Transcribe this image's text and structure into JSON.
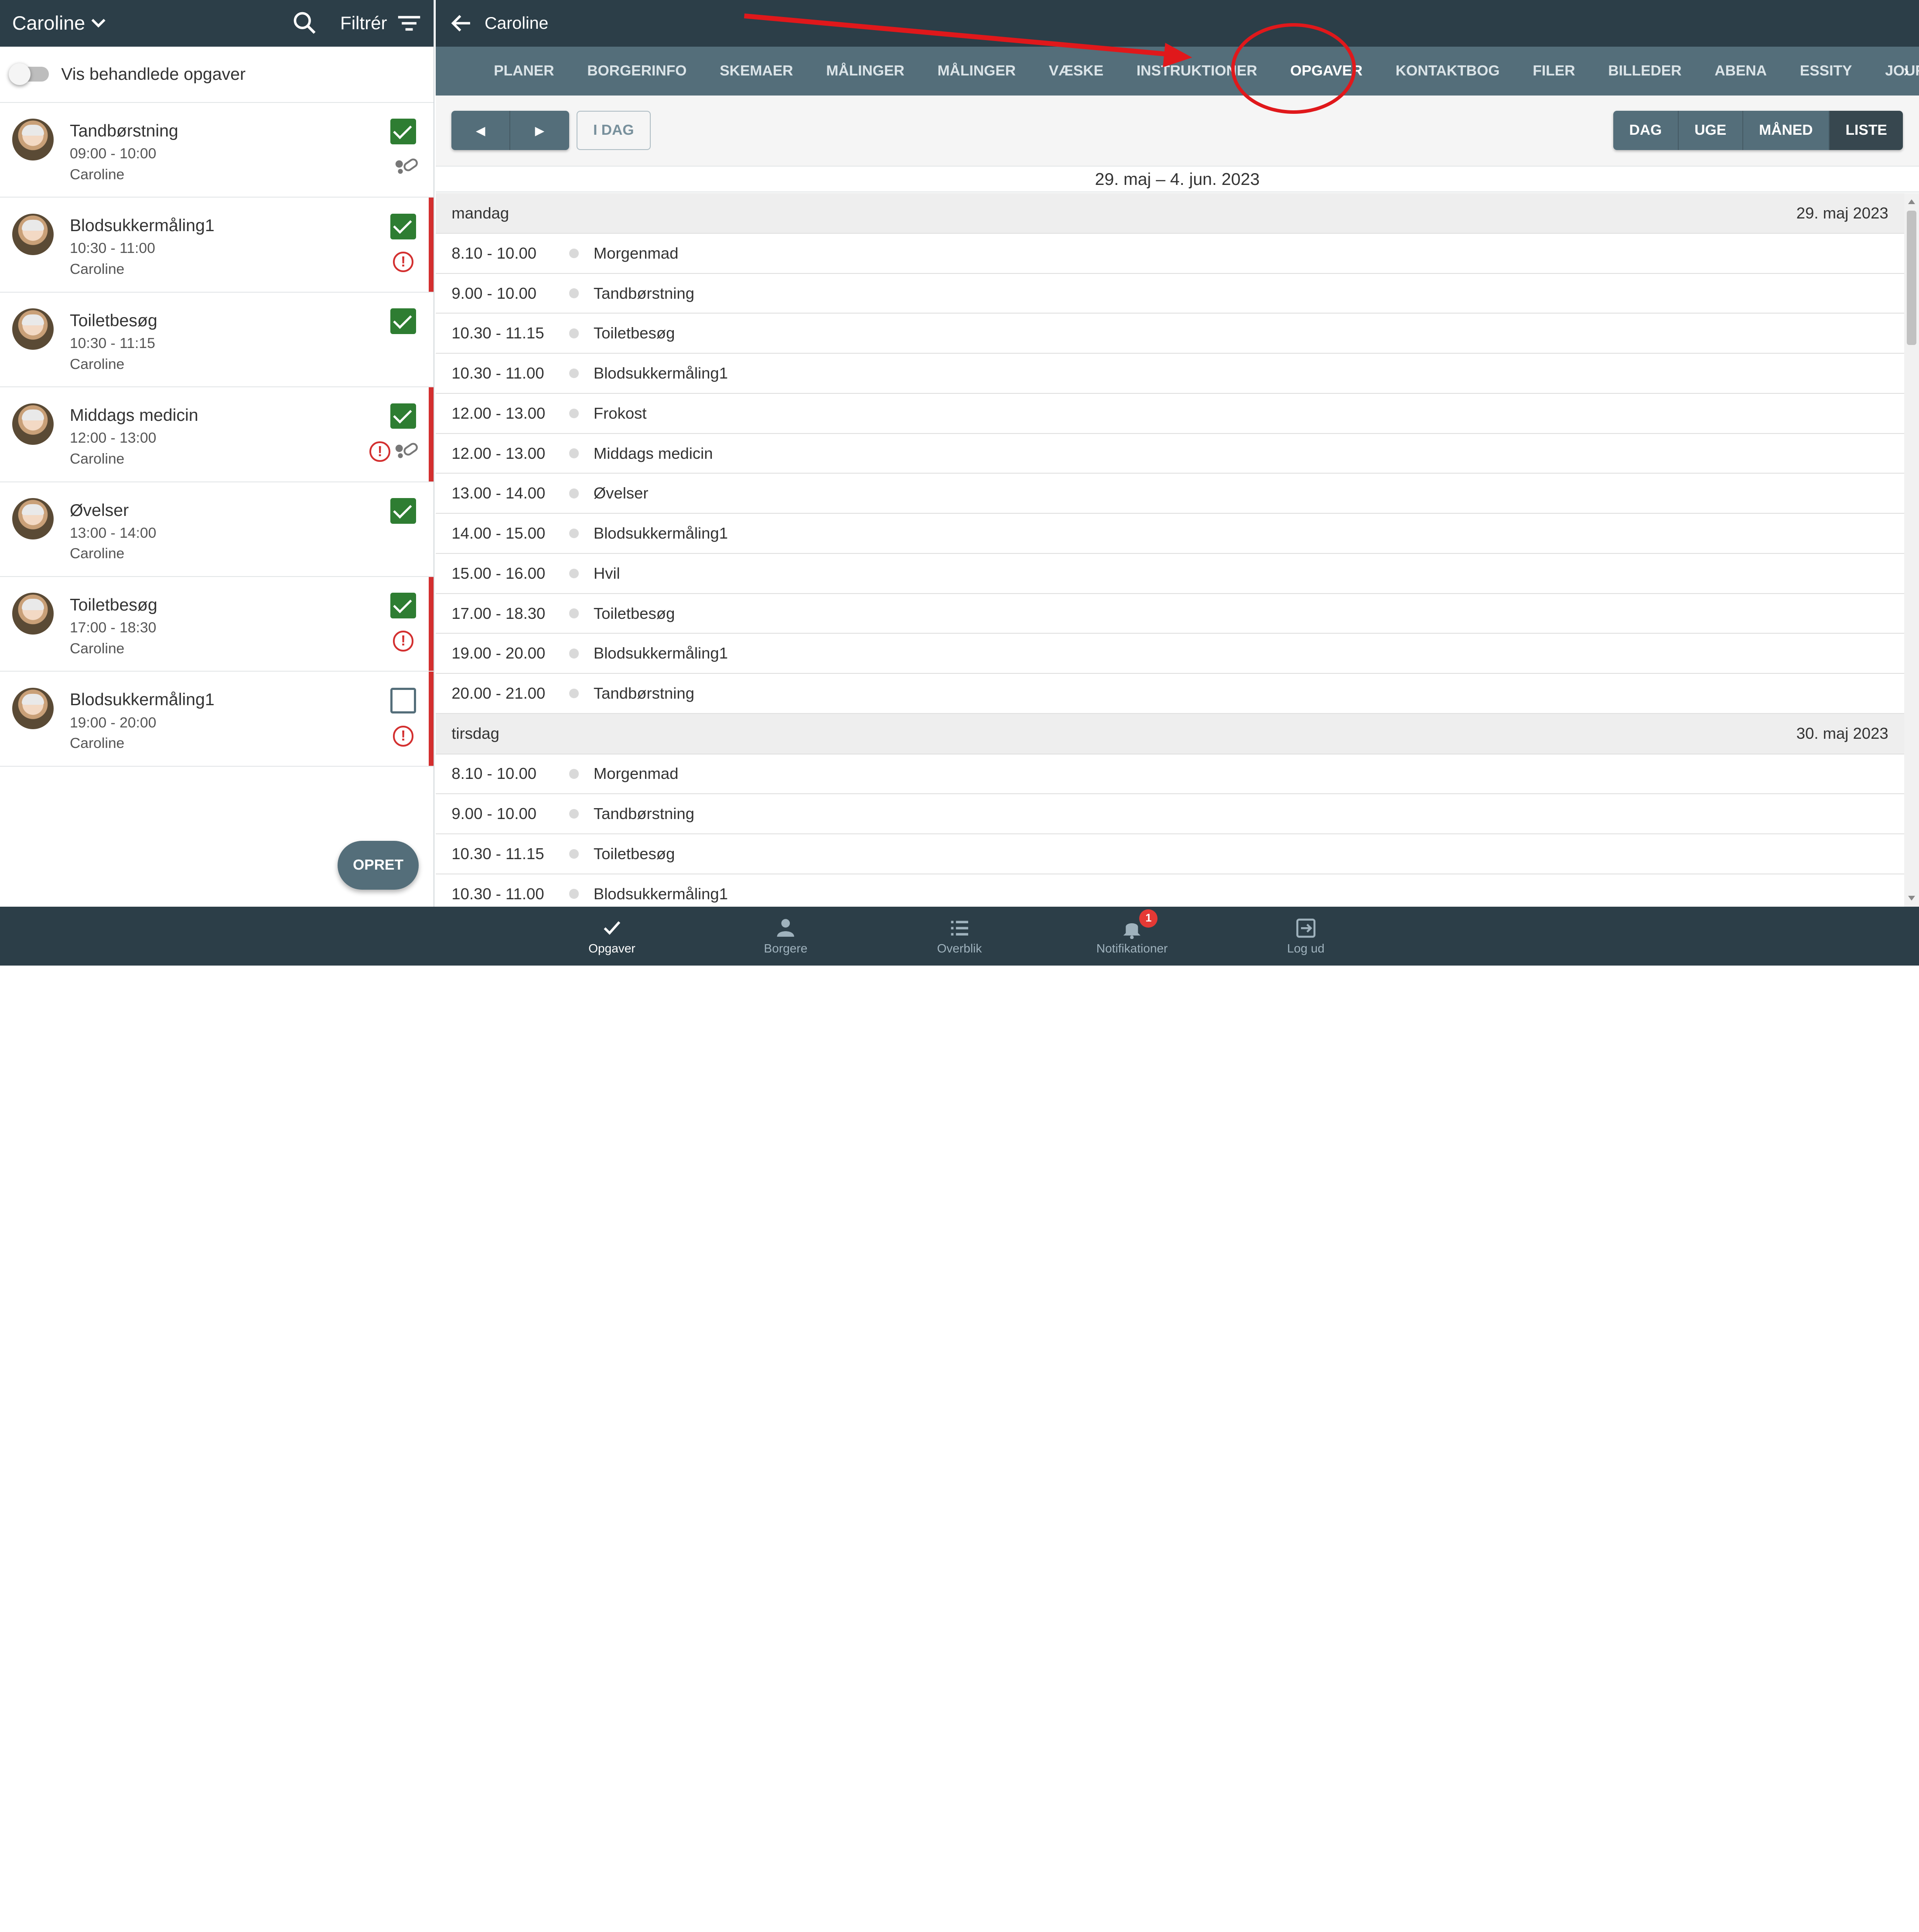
{
  "left_header": {
    "name": "Caroline",
    "filter_label": "Filtrér"
  },
  "toggle": {
    "label": "Vis behandlede opgaver"
  },
  "tasks": [
    {
      "title": "Tandbørstning",
      "time": "09:00 - 10:00",
      "owner": "Caroline",
      "checked": true,
      "alert": false,
      "pill": true,
      "flag": false
    },
    {
      "title": "Blodsukkermåling1",
      "time": "10:30 - 11:00",
      "owner": "Caroline",
      "checked": true,
      "alert": true,
      "pill": false,
      "flag": true
    },
    {
      "title": "Toiletbesøg",
      "time": "10:30 - 11:15",
      "owner": "Caroline",
      "checked": true,
      "alert": false,
      "pill": false,
      "flag": false
    },
    {
      "title": "Middags medicin",
      "time": "12:00 - 13:00",
      "owner": "Caroline",
      "checked": true,
      "alert": true,
      "pill": true,
      "flag": true
    },
    {
      "title": "Øvelser",
      "time": "13:00 - 14:00",
      "owner": "Caroline",
      "checked": true,
      "alert": false,
      "pill": false,
      "flag": false
    },
    {
      "title": "Toiletbesøg",
      "time": "17:00 - 18:30",
      "owner": "Caroline",
      "checked": true,
      "alert": true,
      "pill": false,
      "flag": true
    },
    {
      "title": "Blodsukkermåling1",
      "time": "19:00 - 20:00",
      "owner": "Caroline",
      "checked": false,
      "alert": true,
      "pill": false,
      "flag": true
    }
  ],
  "fab_label": "OPRET",
  "right_header": {
    "title": "Caroline"
  },
  "tabs": [
    "PLANER",
    "BORGERINFO",
    "SKEMAER",
    "MÅLINGER",
    "MÅLINGER",
    "VÆSKE",
    "INSTRUKTIONER",
    "OPGAVER",
    "KONTAKTBOG",
    "FILER",
    "BILLEDER",
    "ABENA",
    "ESSITY",
    "JOURNA"
  ],
  "active_tab": "OPGAVER",
  "toolbar": {
    "today_label": "I DAG",
    "views": [
      "DAG",
      "UGE",
      "MÅNED",
      "LISTE"
    ],
    "active_view": "LISTE"
  },
  "range_label": "29. maj – 4. jun. 2023",
  "days": [
    {
      "weekday": "mandag",
      "date": "29. maj 2023",
      "events": [
        {
          "time": "8.10 - 10.00",
          "title": "Morgenmad"
        },
        {
          "time": "9.00 - 10.00",
          "title": "Tandbørstning"
        },
        {
          "time": "10.30 - 11.15",
          "title": "Toiletbesøg"
        },
        {
          "time": "10.30 - 11.00",
          "title": "Blodsukkermåling1"
        },
        {
          "time": "12.00 - 13.00",
          "title": "Frokost"
        },
        {
          "time": "12.00 - 13.00",
          "title": "Middags medicin"
        },
        {
          "time": "13.00 - 14.00",
          "title": "Øvelser"
        },
        {
          "time": "14.00 - 15.00",
          "title": "Blodsukkermåling1"
        },
        {
          "time": "15.00 - 16.00",
          "title": "Hvil"
        },
        {
          "time": "17.00 - 18.30",
          "title": "Toiletbesøg"
        },
        {
          "time": "19.00 - 20.00",
          "title": "Blodsukkermåling1"
        },
        {
          "time": "20.00 - 21.00",
          "title": "Tandbørstning"
        }
      ]
    },
    {
      "weekday": "tirsdag",
      "date": "30. maj 2023",
      "events": [
        {
          "time": "8.10 - 10.00",
          "title": "Morgenmad"
        },
        {
          "time": "9.00 - 10.00",
          "title": "Tandbørstning"
        },
        {
          "time": "10.30 - 11.15",
          "title": "Toiletbesøg"
        },
        {
          "time": "10.30 - 11.00",
          "title": "Blodsukkermåling1"
        }
      ]
    }
  ],
  "bottom_nav": [
    {
      "label": "Opgaver",
      "icon": "check-icon",
      "active": true
    },
    {
      "label": "Borgere",
      "icon": "person-icon",
      "active": false
    },
    {
      "label": "Overblik",
      "icon": "list-icon",
      "active": false
    },
    {
      "label": "Notifikationer",
      "icon": "bell-icon",
      "active": false,
      "badge": "1"
    },
    {
      "label": "Log ud",
      "icon": "logout-icon",
      "active": false
    }
  ],
  "colors": {
    "header": "#2c3e48",
    "tabbar": "#546e7a",
    "check": "#2e7d32",
    "alert": "#d32f2f",
    "annotation": "#e0181b"
  }
}
